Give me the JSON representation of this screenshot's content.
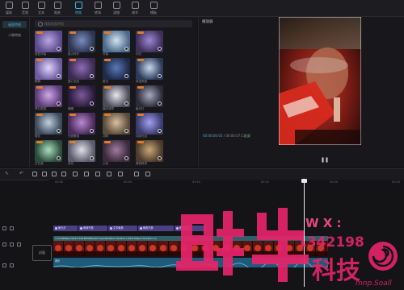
{
  "topbar": {
    "items": [
      {
        "label": "媒体",
        "icon": "media-icon",
        "active": false
      },
      {
        "label": "音频",
        "icon": "audio-icon",
        "active": false
      },
      {
        "label": "文本",
        "icon": "text-icon",
        "active": false
      },
      {
        "label": "贴纸",
        "icon": "sticker-icon",
        "active": false
      },
      {
        "label": "特效",
        "icon": "effects-icon",
        "active": true
      },
      {
        "label": "转场",
        "icon": "transition-icon",
        "active": false
      },
      {
        "label": "滤镜",
        "icon": "filter-icon",
        "active": false
      },
      {
        "label": "调节",
        "icon": "adjust-icon",
        "active": false
      },
      {
        "label": "模板",
        "icon": "template-icon",
        "active": false
      }
    ]
  },
  "sidebar": {
    "items": [
      {
        "label": "画面特效",
        "active": true
      },
      {
        "label": "人物特效",
        "active": false
      }
    ]
  },
  "library": {
    "search_placeholder": "搜索画面特效",
    "thumb_labels": [
      "渐显开幕",
      "星火炸开",
      "开幕",
      "闪白",
      "模糊",
      "爱心泡泡",
      "星空",
      "浪漫氛围",
      "梦幻氛围",
      "蝴蝶",
      "横纹故障",
      "聚光灯",
      "雪花",
      "光斑飘落",
      "冲刺",
      "动感光波",
      "文艺感",
      "荧光",
      "心动",
      "暗夜精灵"
    ]
  },
  "player": {
    "title": "播放器",
    "current_time": "00:00:06:05",
    "total_time": "00:00:07:13",
    "fullscreen_label": "全屏",
    "pause_icon": "pause-icon"
  },
  "ruler": {
    "ticks": [
      "00:00",
      "00:05",
      "00:10",
      "00:15",
      "00:20",
      "00:25"
    ]
  },
  "timeline": {
    "fx_clips": [
      "聚光灯",
      "雨滴失焦",
      "文字聚焦",
      "聚焦失焦",
      "横纹故障"
    ],
    "text_track": "x=21469&a=0&b=22G3ED85&sdk=seededat&x=4cd8x4+Ya57r2Q&e=411&b=+e",
    "audio_label": "音乐",
    "cover_label": "封面"
  },
  "watermark": {
    "wx": "W X :",
    "number": "1342198",
    "brand_text": "科技",
    "suffix": "mnp.Soall"
  },
  "colors": {
    "accent": "#3fb7e6",
    "fx_clip": "#4b3f86",
    "audio": "#205a7a",
    "watermark_pink": "#e6246a"
  }
}
